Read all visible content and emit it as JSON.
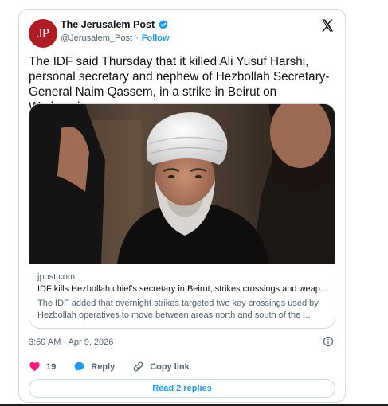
{
  "account": {
    "avatar_text": "JP",
    "name": "The Jerusalem Post",
    "handle": "@Jerusalem_Post",
    "separator": "·",
    "follow_label": "Follow"
  },
  "tweet": {
    "text": "The IDF said Thursday that it killed Ali Yusuf Harshi, personal secretary and nephew of Hezbollah Secretary-General Naim Qassem, in a strike in Beirut on Wednesday.",
    "link_card": {
      "domain": "jpost.com",
      "title": "IDF kills Hezbollah chief's secretary in Beirut, strikes crossings and weap...",
      "description": "The IDF added that overnight strikes targeted two key crossings used by Hezbollah operatives to move between areas north and south of the ..."
    },
    "timestamp": "3:59 AM · Apr 9, 2026"
  },
  "actions": {
    "like_count": "19",
    "reply_label": "Reply",
    "copy_link_label": "Copy link"
  },
  "read_replies_label": "Read 2 replies",
  "colors": {
    "accent": "#1d9bf0",
    "like": "#f91880",
    "avatar_bg": "#b01c24",
    "border": "#cfd9de"
  },
  "icons": [
    "verified-badge-icon",
    "x-logo-icon",
    "info-icon",
    "heart-icon",
    "reply-bubble-icon",
    "link-icon"
  ]
}
